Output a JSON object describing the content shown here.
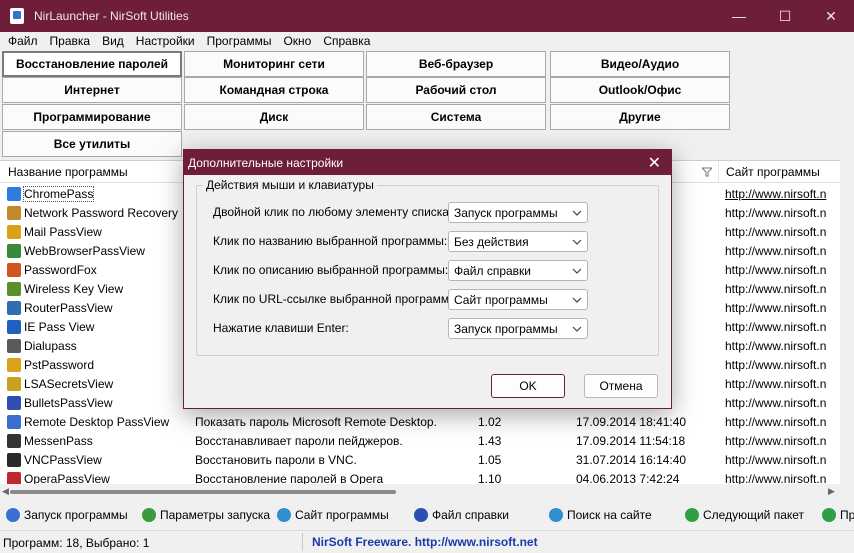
{
  "window": {
    "title": "NirLauncher  -  NirSoft Utilities",
    "minimize_glyph": "—",
    "maximize_glyph": "☐",
    "close_glyph": "✕",
    "accent": "#6e1e3a"
  },
  "menu": [
    "Файл",
    "Правка",
    "Вид",
    "Настройки",
    "Программы",
    "Окно",
    "Справка"
  ],
  "categories": [
    [
      "Восстановление паролей",
      "Мониторинг сети",
      "Веб-браузер",
      "Видео/Аудио"
    ],
    [
      "Интернет",
      "Командная строка",
      "Рабочий стол",
      "Outlook/Офис"
    ],
    [
      "Программирование",
      "Диск",
      "Система",
      "Другие"
    ],
    [
      "Все утилиты"
    ]
  ],
  "list": {
    "columns": {
      "name": "Название программы",
      "site": "Сайт программы"
    },
    "rows": [
      {
        "name": "ChromePass",
        "desc": "",
        "ver": "",
        "date": "",
        "site": "http://www.nirsoft.n",
        "icon": "chrome-icon"
      },
      {
        "name": "Network Password Recovery",
        "desc": "",
        "ver": "",
        "date": "",
        "site": "http://www.nirsoft.n",
        "icon": "key-icon"
      },
      {
        "name": "Mail PassView",
        "desc": "",
        "ver": "",
        "date": "",
        "site": "http://www.nirsoft.n",
        "icon": "mail-icon"
      },
      {
        "name": "WebBrowserPassView",
        "desc": "",
        "ver": "",
        "date": "",
        "site": "http://www.nirsoft.n",
        "icon": "browser-icon"
      },
      {
        "name": "PasswordFox",
        "desc": "",
        "ver": "",
        "date": "",
        "site": "http://www.nirsoft.n",
        "icon": "firefox-icon"
      },
      {
        "name": "Wireless Key View",
        "desc": "",
        "ver": "",
        "date": "",
        "site": "http://www.nirsoft.n",
        "icon": "wifi-icon"
      },
      {
        "name": "RouterPassView",
        "desc": "",
        "ver": "",
        "date": "",
        "site": "http://www.nirsoft.n",
        "icon": "router-icon"
      },
      {
        "name": "IE Pass View",
        "desc": "",
        "ver": "",
        "date": "",
        "site": "http://www.nirsoft.n",
        "icon": "ie-icon"
      },
      {
        "name": "Dialupass",
        "desc": "",
        "ver": "",
        "date": "",
        "site": "http://www.nirsoft.n",
        "icon": "phone-icon"
      },
      {
        "name": "PstPassword",
        "desc": "",
        "ver": "",
        "date": "",
        "site": "http://www.nirsoft.n",
        "icon": "pst-icon"
      },
      {
        "name": "LSASecretsView",
        "desc": "",
        "ver": "",
        "date": "",
        "site": "http://www.nirsoft.n",
        "icon": "lsa-key-icon"
      },
      {
        "name": "BulletsPassView",
        "desc": "",
        "ver": "",
        "date": "",
        "site": "http://www.nirsoft.n",
        "icon": "bullets-icon"
      },
      {
        "name": "Remote Desktop PassView",
        "desc": "Показать пароль Microsoft Remote Desktop.",
        "ver": "1.02",
        "date": "17.09.2014 18:41:40",
        "site": "http://www.nirsoft.n",
        "icon": "remote-desktop-icon"
      },
      {
        "name": "MessenPass",
        "desc": "Восстанавливает пароли пейджеров.",
        "ver": "1.43",
        "date": "17.09.2014 11:54:18",
        "site": "http://www.nirsoft.n",
        "icon": "messenger-icon"
      },
      {
        "name": "VNCPassView",
        "desc": "Восстановить пароли в VNC.",
        "ver": "1.05",
        "date": "31.07.2014 16:14:40",
        "site": "http://www.nirsoft.n",
        "icon": "vnc-icon"
      },
      {
        "name": "OperaPassView",
        "desc": "Восстановление паролей в Opera",
        "ver": "1.10",
        "date": "04.06.2013 7:42:24",
        "site": "http://www.nirsoft.n",
        "icon": "opera-icon"
      }
    ]
  },
  "toolbar": [
    {
      "label": "Запуск программы",
      "icon": "run-icon",
      "color": "#3a6fd0"
    },
    {
      "label": "Параметры запуска",
      "icon": "params-icon",
      "color": "#3c9a3c"
    },
    {
      "label": "Сайт программы",
      "icon": "globe-icon",
      "color": "#2f8fd0"
    },
    {
      "label": "Файл справки",
      "icon": "help-icon",
      "color": "#2a4fb0"
    },
    {
      "label": "Поиск на сайте",
      "icon": "search-globe-icon",
      "color": "#2f8fd0"
    },
    {
      "label": "Следующий пакет",
      "icon": "arrow-up-icon",
      "color": "#2ea043"
    },
    {
      "label": "Пр",
      "icon": "arrow-down-icon",
      "color": "#2ea043"
    }
  ],
  "status": {
    "left": "Программ: 18, Выбрано: 1",
    "link": "NirSoft Freeware.  http://www.nirsoft.net"
  },
  "dialog": {
    "title": "Дополнительные настройки",
    "group_label": "Действия мыши и клавиатуры",
    "options": [
      {
        "label": "Двойной клик по любому элементу списка:",
        "value": "Запуск программы"
      },
      {
        "label": "Клик по названию выбранной программы:",
        "value": "Без действия"
      },
      {
        "label": "Клик по описанию выбранной программы:",
        "value": "Файл справки"
      },
      {
        "label": "Клик по URL-ссылке выбранной программы:",
        "value": "Сайт программы"
      },
      {
        "label": "Нажатие клавиши Enter:",
        "value": "Запуск программы"
      }
    ],
    "ok_label": "OK",
    "cancel_label": "Отмена"
  }
}
